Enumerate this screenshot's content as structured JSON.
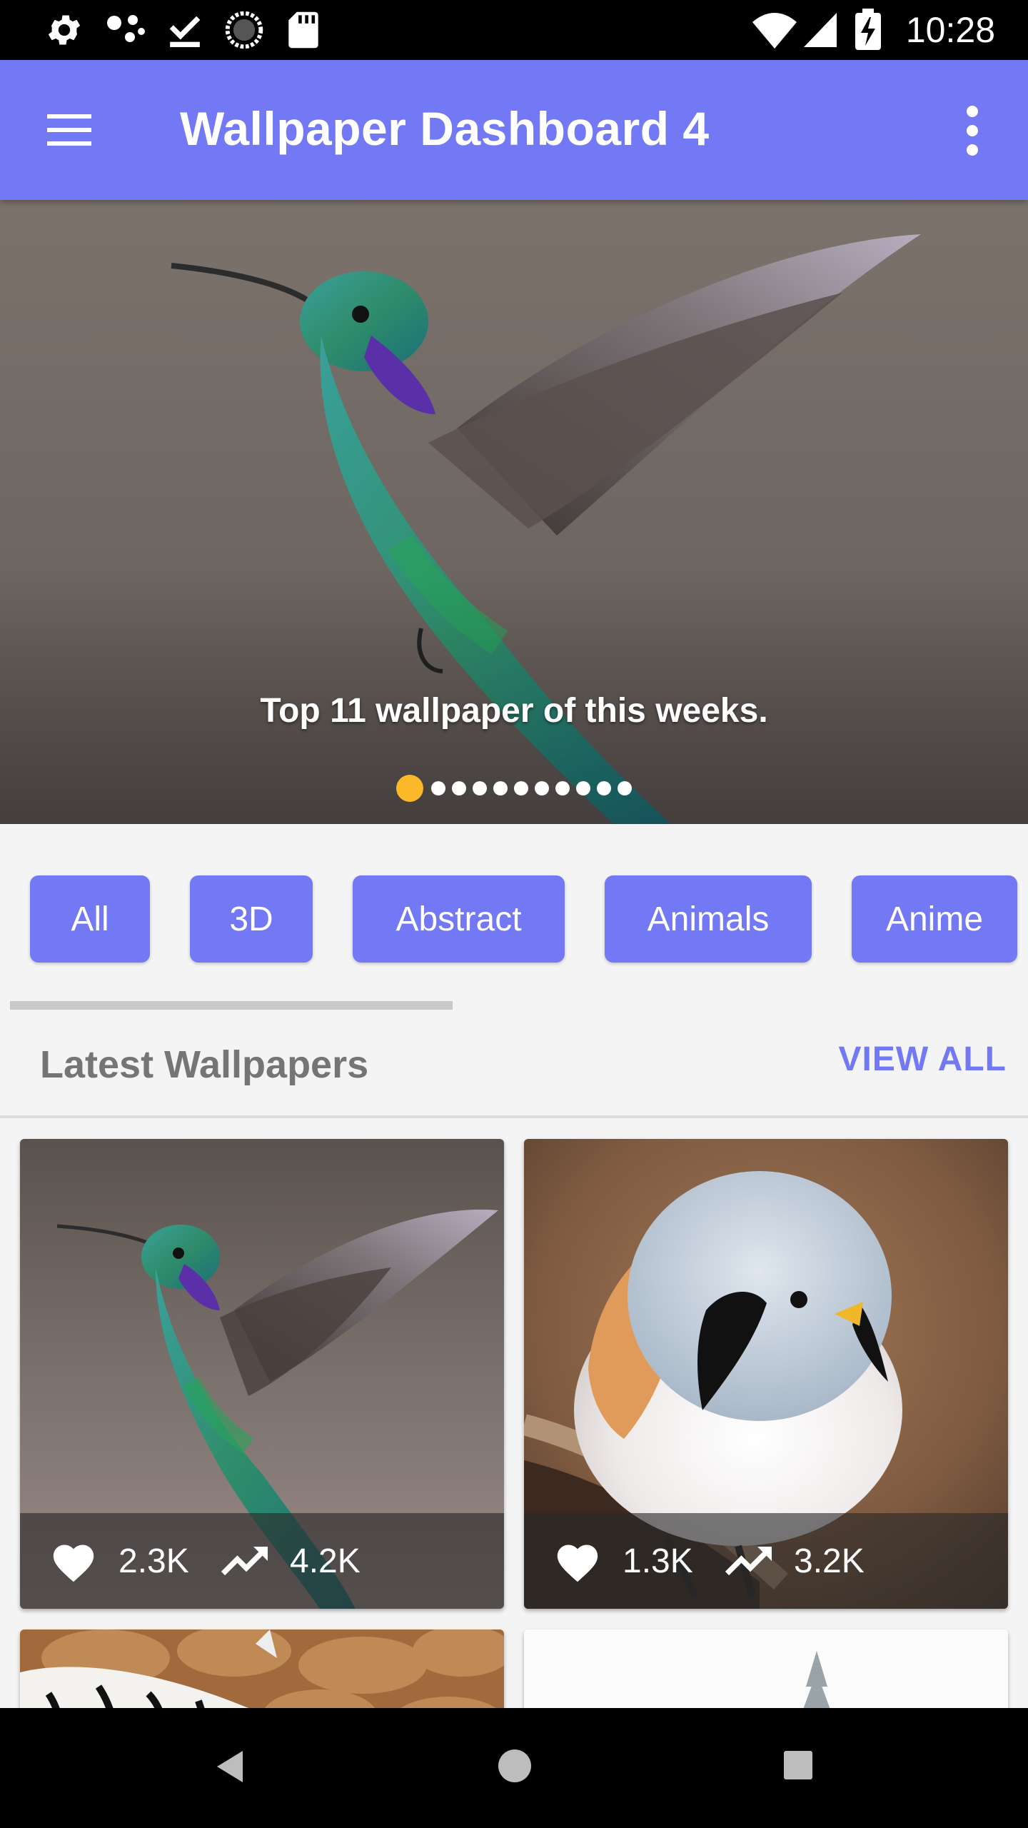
{
  "status_bar": {
    "time": "10:28",
    "icons": [
      "gear-icon",
      "assistant-dots-icon",
      "download-done-icon",
      "sync-circle-icon",
      "sd-card-icon",
      "wifi-icon",
      "signal-icon",
      "battery-charging-icon"
    ]
  },
  "app_bar": {
    "title": "Wallpaper Dashboard 4",
    "menu_icon": "hamburger-menu-icon",
    "more_icon": "more-vertical-icon"
  },
  "hero": {
    "caption": "Top 11 wallpaper of this weeks.",
    "slide_count": 11,
    "active_slide": 1,
    "colors": {
      "active_dot": "#fbb829",
      "inactive_dot": "#ffffff"
    }
  },
  "categories": [
    "All",
    "3D",
    "Abstract",
    "Animals",
    "Anime"
  ],
  "latest": {
    "title": "Latest Wallpapers",
    "view_all": "VIEW ALL",
    "cards": [
      {
        "likes": "2.3K",
        "views": "4.2K",
        "subject": "hummingbird"
      },
      {
        "likes": "1.3K",
        "views": "3.2K",
        "subject": "bearded-reedling"
      }
    ]
  },
  "theme": {
    "primary": "#7379f4",
    "accent": "#fbb829"
  }
}
